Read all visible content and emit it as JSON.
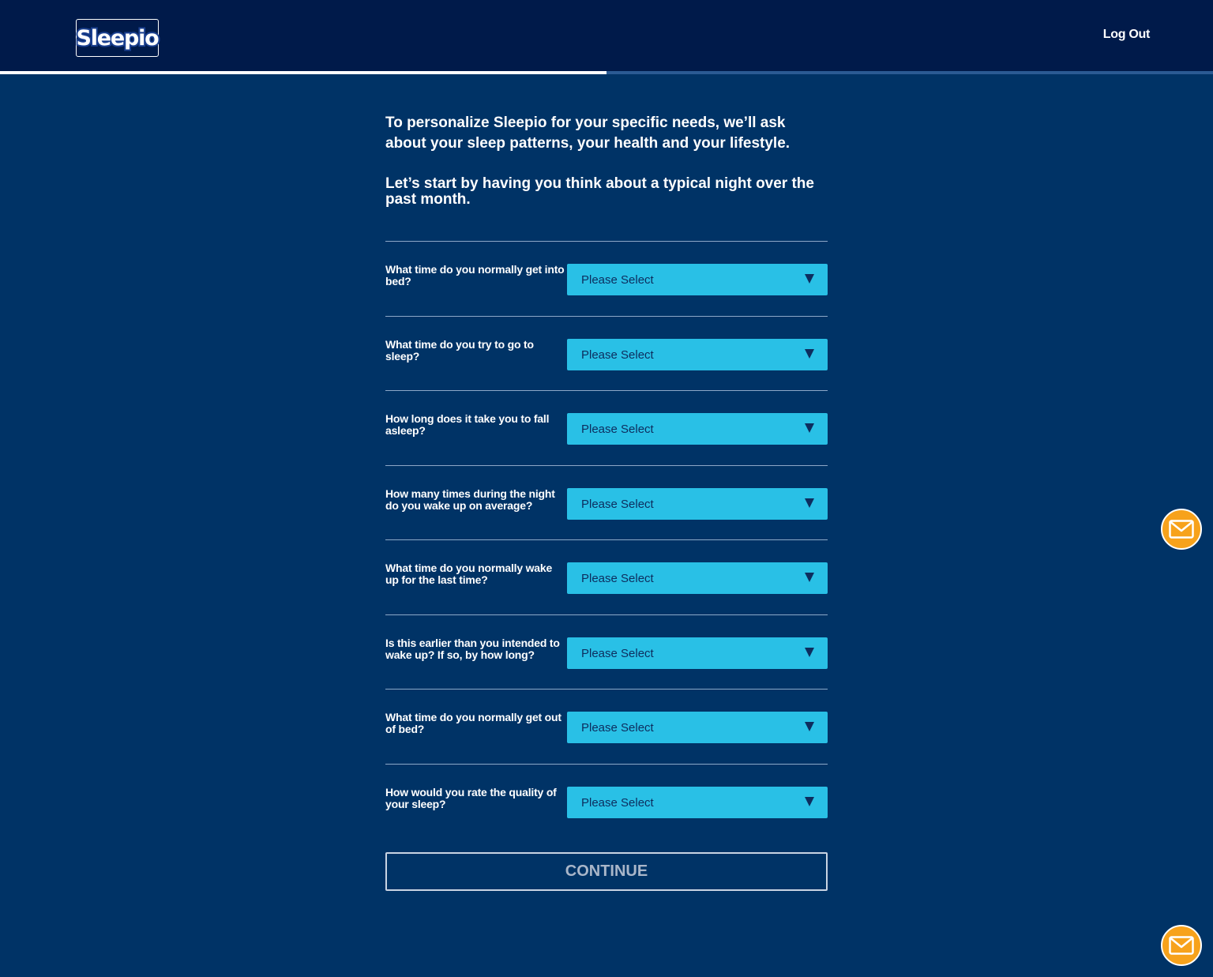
{
  "header": {
    "logo_text": "Sleepio",
    "logout_label": "Log Out"
  },
  "progress": {
    "fraction": 0.5
  },
  "intro": {
    "paragraph1": "To personalize Sleepio for your specific needs, we’ll ask about your sleep patterns, your health and your lifestyle.",
    "paragraph2": "Let’s start by having you think about a typical night over the past month."
  },
  "questions": [
    {
      "label": "What time do you normally get into bed?",
      "selected": "Please Select"
    },
    {
      "label": "What time do you try to go to sleep?",
      "selected": "Please Select"
    },
    {
      "label": "How long does it take you to fall asleep?",
      "selected": "Please Select"
    },
    {
      "label": "How many times during the night do you wake up on average?",
      "selected": "Please Select"
    },
    {
      "label": "What time do you normally wake up for the last time?",
      "selected": "Please Select"
    },
    {
      "label": "Is this earlier than you intended to wake up? If so, by how long?",
      "selected": "Please Select"
    },
    {
      "label": "What time do you normally get out of bed?",
      "selected": "Please Select"
    },
    {
      "label": "How would you rate the quality of your sleep?",
      "selected": "Please Select"
    }
  ],
  "continue_label": "CONTINUE",
  "colors": {
    "background": "#003366",
    "header": "#001a4a",
    "select": "#29c0e6",
    "mail_button": "#f7a21b"
  },
  "icons": {
    "mail": "envelope-icon",
    "dropdown": "triangle-down-icon"
  }
}
